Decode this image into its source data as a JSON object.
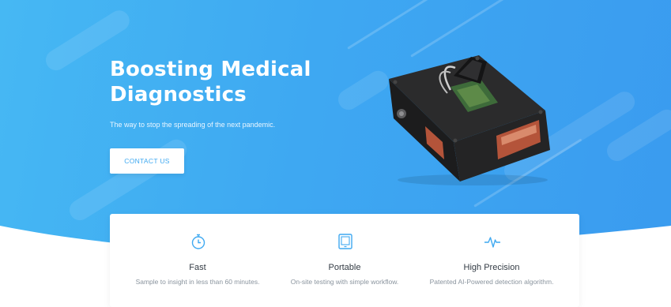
{
  "hero": {
    "title": "Boosting Medical Diagnostics",
    "subtitle": "The way to stop the spreading of the next pandemic.",
    "cta_label": "CONTACT US",
    "device_image": "diagnostic-device-photo"
  },
  "features": [
    {
      "icon": "stopwatch-icon",
      "title": "Fast",
      "description": "Sample to insight in less than 60 minutes."
    },
    {
      "icon": "tablet-icon",
      "title": "Portable",
      "description": "On-site testing with simple workflow."
    },
    {
      "icon": "pulse-icon",
      "title": "High Precision",
      "description": "Patented AI-Powered detection algorithm."
    }
  ],
  "colors": {
    "accent": "#3fa9f1",
    "hero_start": "#46b8f3",
    "hero_end": "#3a9bef",
    "text_dark": "#333b44",
    "text_muted": "#8a949e"
  }
}
